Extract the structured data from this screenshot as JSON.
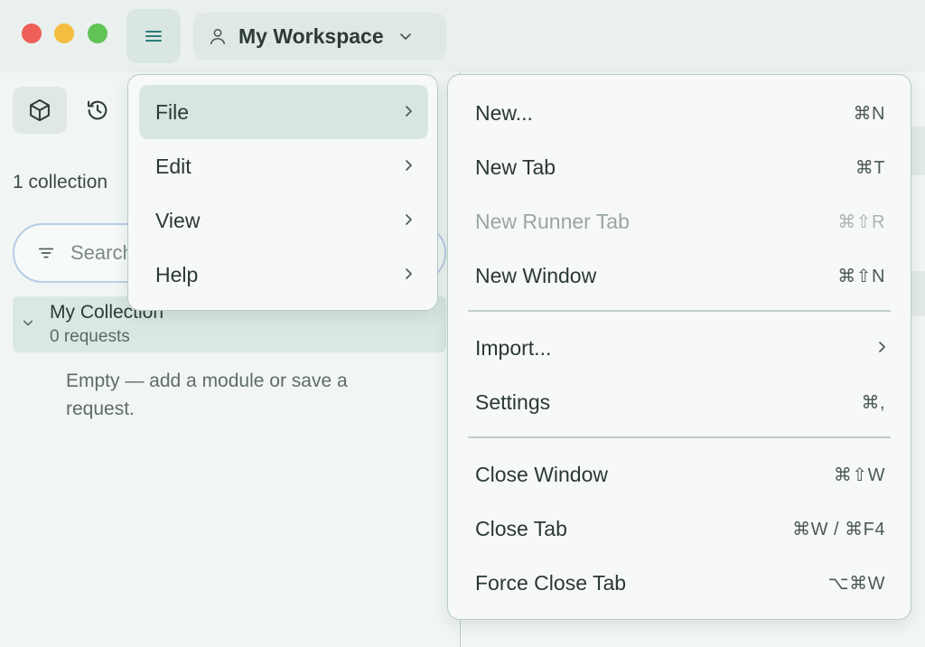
{
  "workspace": {
    "name": "My Workspace"
  },
  "sidebar": {
    "collection_count": "1 collection",
    "search_placeholder": "Search",
    "collection": {
      "name": "My Collection",
      "requests": "0 requests"
    },
    "empty_message": "Empty — add a module or save a request."
  },
  "main_menu": {
    "items": [
      {
        "label": "File"
      },
      {
        "label": "Edit"
      },
      {
        "label": "View"
      },
      {
        "label": "Help"
      }
    ]
  },
  "file_menu": {
    "items": [
      {
        "label": "New...",
        "shortcut": "⌘N"
      },
      {
        "label": "New Tab",
        "shortcut": "⌘T"
      },
      {
        "label": "New Runner Tab",
        "shortcut": "⌘⇧R",
        "disabled": true
      },
      {
        "label": "New Window",
        "shortcut": "⌘⇧N"
      },
      {
        "label": "Import...",
        "shortcut": ""
      },
      {
        "label": "Settings",
        "shortcut": "⌘,"
      },
      {
        "label": "Close Window",
        "shortcut": "⌘⇧W"
      },
      {
        "label": "Close Tab",
        "shortcut": "⌘W / ⌘F4"
      },
      {
        "label": "Force Close Tab",
        "shortcut": "⌥⌘W"
      }
    ]
  },
  "colors": {
    "accent": "#2f7d78",
    "close": "#ee5f57",
    "minimize": "#f4bd3f",
    "zoom": "#5fc454"
  }
}
